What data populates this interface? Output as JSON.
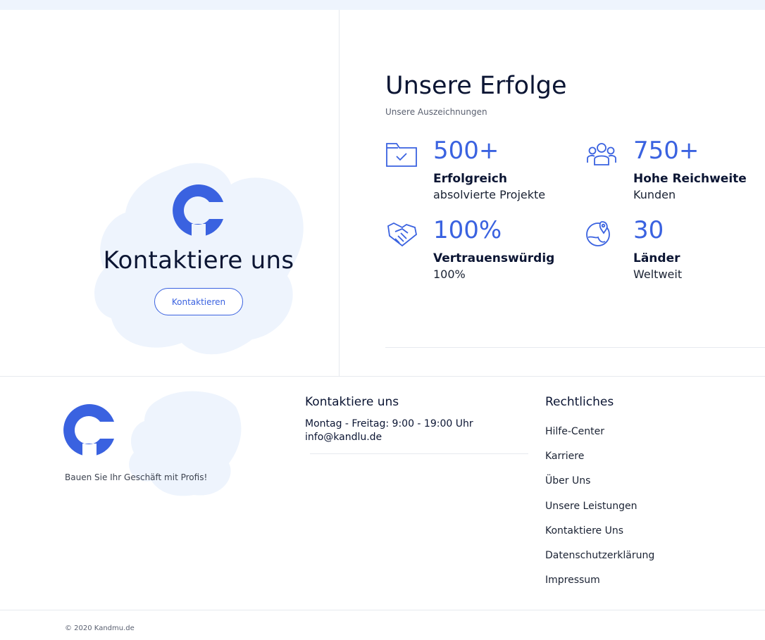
{
  "hero": {
    "title": "Kontaktiere uns",
    "button_label": "Kontaktieren"
  },
  "achievements": {
    "title": "Unsere Erfolge",
    "subtitle": "Unsere Auszeichnungen",
    "stats": [
      {
        "icon": "folder-check-icon",
        "value": "500+",
        "label": "Erfolgreich",
        "desc": "absolvierte Projekte"
      },
      {
        "icon": "users-group-icon",
        "value": "750+",
        "label": "Hohe Reichweite",
        "desc": "Kunden"
      },
      {
        "icon": "handshake-icon",
        "value": "100%",
        "label": "Vertrauenswürdig",
        "desc": "100%"
      },
      {
        "icon": "globe-pin-icon",
        "value": "30",
        "label": "Länder",
        "desc": "Weltweit"
      }
    ]
  },
  "footer": {
    "tagline": "Bauen Sie Ihr Geschäft mit Profis!",
    "contact": {
      "heading": "Kontaktiere uns",
      "hours": "Montag - Freitag: 9:00 - 19:00 Uhr",
      "email": "info@kandlu.de"
    },
    "legal": {
      "heading": "Rechtliches",
      "links": [
        "Hilfe-Center",
        "Karriere",
        "Über Uns",
        "Unsere Leistungen",
        "Kontaktiere Uns",
        "Datenschutzerklärung",
        "Impressum"
      ]
    },
    "copyright": "© 2020 Kandmu.de"
  },
  "colors": {
    "accent": "#3a62e0",
    "text_dark": "#0b1533",
    "blob": "#eef4fd"
  }
}
